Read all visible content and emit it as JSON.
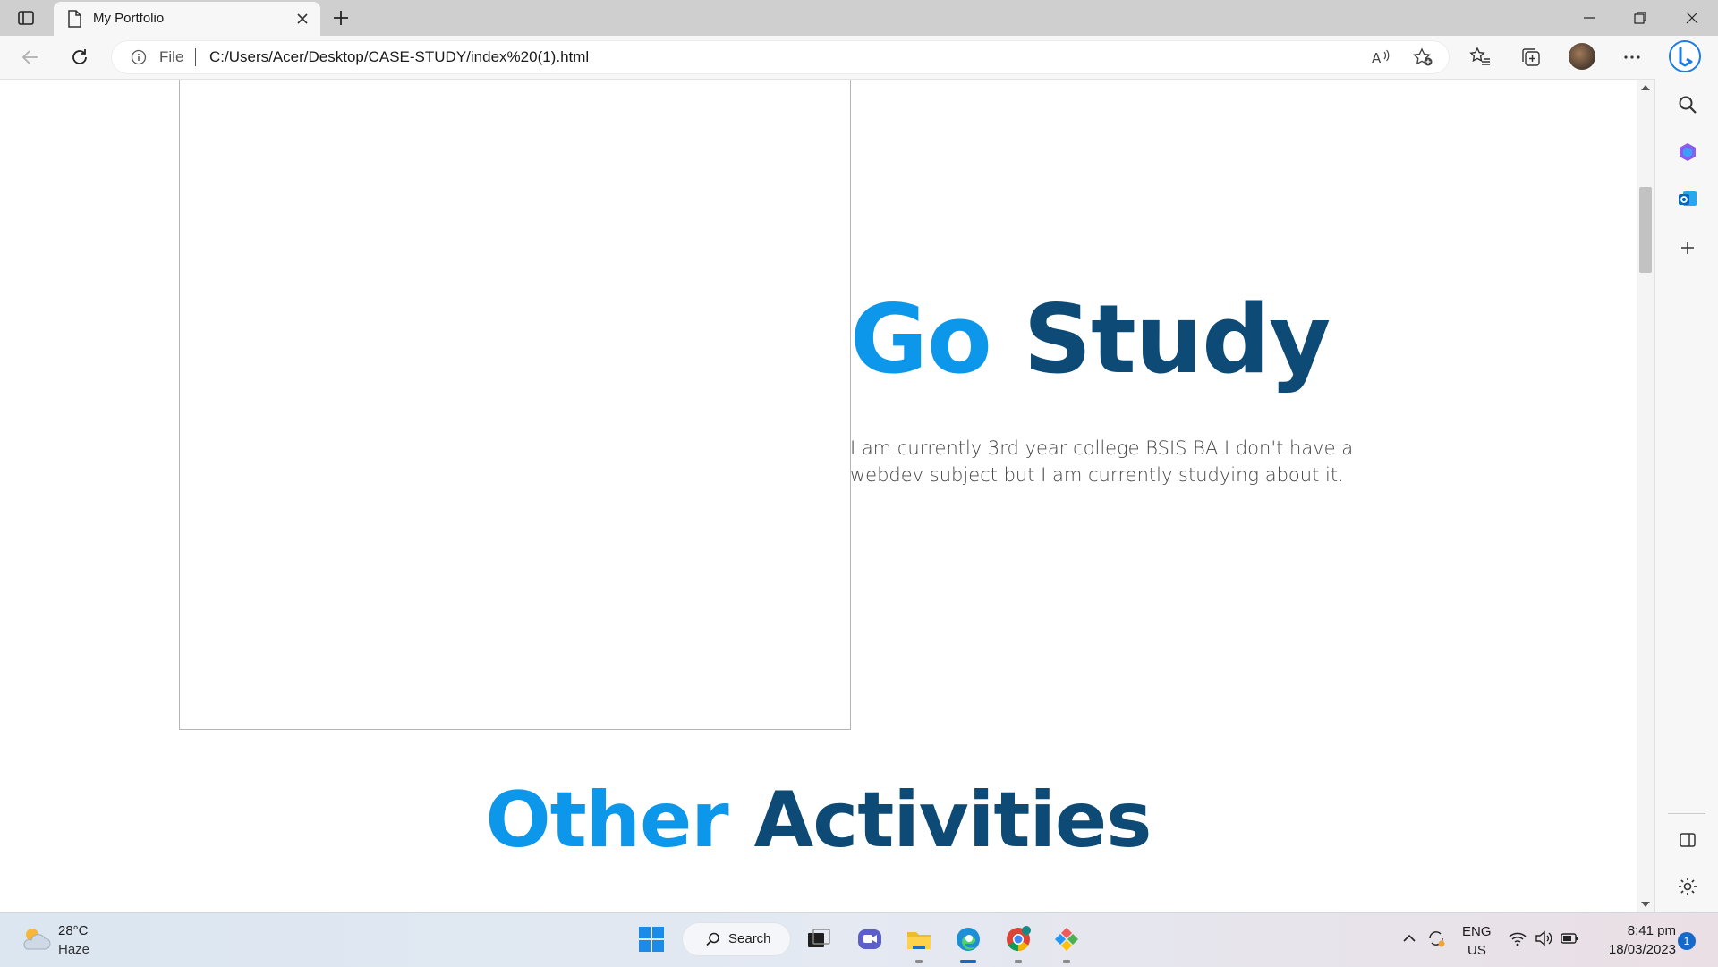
{
  "browser": {
    "tab": {
      "title": "My Portfolio"
    },
    "address": {
      "scheme_label": "File",
      "url": "C:/Users/Acer/Desktop/CASE-STUDY/index%20(1).html"
    },
    "icons": [
      "tab-actions-icon",
      "page-icon",
      "close-icon",
      "new-tab-icon",
      "minimize-icon",
      "restore-icon",
      "window-close-icon",
      "back-icon",
      "refresh-icon",
      "info-icon",
      "read-aloud-icon",
      "add-favorite-icon",
      "favorites-icon",
      "collections-icon",
      "profile-avatar",
      "more-icon",
      "bing-icon"
    ]
  },
  "sidepanel": {
    "icons": [
      "search-icon",
      "copilot-icon",
      "outlook-icon",
      "add-icon",
      "split-screen-icon",
      "settings-icon"
    ]
  },
  "page": {
    "hero": {
      "heading_word1": "Go",
      "heading_word2": "Study",
      "paragraph": "I am currently 3rd year college BSIS BA I don't have a webdev subject but I am currently studying about it."
    },
    "section2": {
      "heading_word1": "Other",
      "heading_word2": "Activities"
    },
    "colors": {
      "accent": "#0c97ea",
      "dark": "#0d4a75",
      "text": "#444444"
    }
  },
  "taskbar": {
    "weather": {
      "temp": "28°C",
      "condition": "Haze"
    },
    "search_label": "Search",
    "apps": [
      "start-icon",
      "task-view-icon",
      "chat-icon",
      "file-explorer-icon",
      "edge-icon",
      "chrome-icon",
      "app-icon"
    ],
    "tray": {
      "lang_line1": "ENG",
      "lang_line2": "US",
      "time": "8:41 pm",
      "date": "18/03/2023",
      "notification_count": "1"
    }
  }
}
